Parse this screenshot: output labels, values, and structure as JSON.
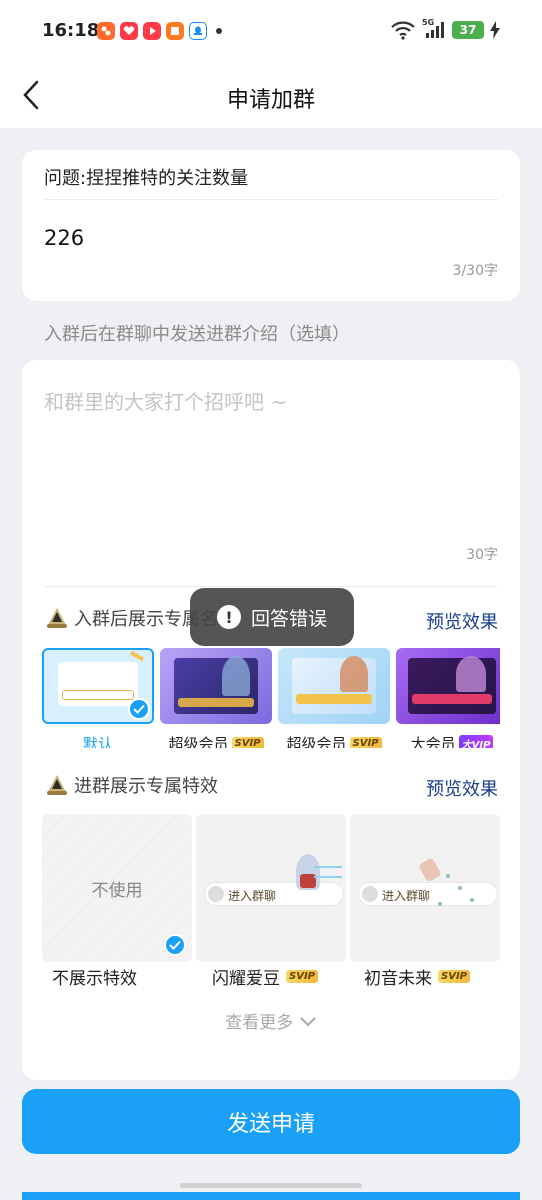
{
  "status_bar": {
    "time": "16:18",
    "battery": "37",
    "network": "5G"
  },
  "nav": {
    "title": "申请加群"
  },
  "question_card": {
    "question": "问题:捏捏推特的关注数量",
    "answer": "226",
    "counter": "3/30字"
  },
  "intro": {
    "hint": "入群后在群聊中发送进群介绍（选填）",
    "placeholder": "和群里的大家打个招呼吧 ~",
    "counter": "30字"
  },
  "card_section": {
    "title": "入群后展示专属名片",
    "preview": "预览效果",
    "cards": [
      {
        "label": "默认",
        "tag": "",
        "selected": true
      },
      {
        "label": "超级会员",
        "tag": "SVIP",
        "selected": false
      },
      {
        "label": "超级会员",
        "tag": "SVIP",
        "selected": false
      },
      {
        "label": "大会员",
        "tag": "大VIP",
        "selected": false
      }
    ]
  },
  "effect_section": {
    "title": "进群展示专属特效",
    "preview": "预览效果",
    "effects": [
      {
        "label": "不展示特效",
        "inner": "不使用",
        "tag": "",
        "selected": true
      },
      {
        "label": "闪耀爱豆",
        "inner": "进入群聊",
        "tag": "SVIP",
        "selected": false
      },
      {
        "label": "初音未来",
        "inner": "进入群聊",
        "tag": "SVIP",
        "selected": false
      }
    ],
    "see_more": "查看更多"
  },
  "submit": {
    "label": "发送申请"
  },
  "toast": {
    "text": "回答错误"
  },
  "colors": {
    "accent": "#1aa1f7",
    "link": "#1a3f8f",
    "page_bg": "#eef0f3"
  }
}
